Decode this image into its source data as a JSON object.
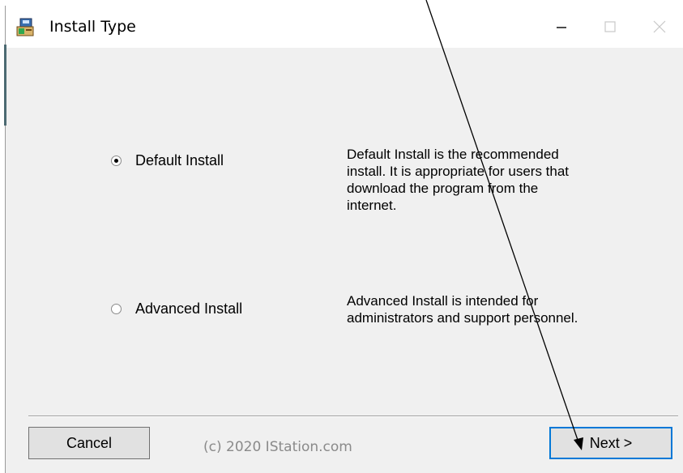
{
  "window": {
    "title": "Install Type",
    "controls": {
      "minimize": "—",
      "maximize": "□",
      "close": "✕"
    }
  },
  "options": [
    {
      "label": "Default Install",
      "checked": true,
      "description_lines": [
        "Default Install is the recommended",
        "install. It is appropriate for users that",
        "download the program from the",
        "internet."
      ]
    },
    {
      "label": "Advanced Install",
      "checked": false,
      "description_lines": [
        "Advanced Install is intended for",
        "administrators and support personnel."
      ]
    }
  ],
  "footer": {
    "cancel_label": "Cancel",
    "copyright": "(c) 2020 IStation.com",
    "next_label": "Next >"
  },
  "icons": {
    "title": "installer-icon",
    "annotation": "arrow-annotation"
  },
  "colors": {
    "focus": "#0078d7",
    "window_bg": "#f0f0f0"
  }
}
